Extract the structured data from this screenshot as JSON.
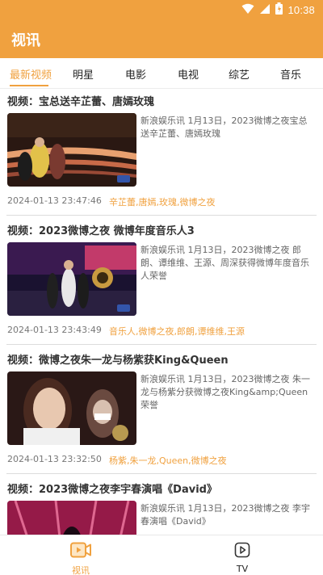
{
  "status_bar": {
    "time": "10:38"
  },
  "app": {
    "title": "视讯"
  },
  "tabs": [
    {
      "label": "最新视频",
      "active": true
    },
    {
      "label": "明星"
    },
    {
      "label": "电影"
    },
    {
      "label": "电视"
    },
    {
      "label": "综艺"
    },
    {
      "label": "音乐"
    }
  ],
  "feed": [
    {
      "title": "视频：宝总送辛芷蕾、唐嫣玫瑰",
      "snippet": "新浪娱乐讯 1月13日，2023微博之夜宝总送辛芷蕾、唐嫣玫瑰",
      "date": "2024-01-13 23:47:46",
      "tags": "辛芷蕾,唐嫣,玫瑰,微博之夜"
    },
    {
      "title": "视频：2023微博之夜 微博年度音乐人3",
      "snippet": "新浪娱乐讯 1月13日，2023微博之夜 郎朗、谭维维、王源、周深获得微博年度音乐人荣誉",
      "date": "2024-01-13 23:43:49",
      "tags": "音乐人,微博之夜,郎朗,谭维维,王源"
    },
    {
      "title": "视频：微博之夜朱一龙与杨紫获King&Queen",
      "snippet": "新浪娱乐讯 1月13日，2023微博之夜 朱一龙与杨紫分获微博之夜King&amp;Queen荣誉",
      "date": "2024-01-13 23:32:50",
      "tags": "杨紫,朱一龙,Queen,微博之夜"
    },
    {
      "title": "视频：2023微博之夜李宇春演唱《David》",
      "snippet": "新浪娱乐讯 1月13日，2023微博之夜 李宇春演唱《David》",
      "date": "",
      "tags": ""
    }
  ],
  "bottom_nav": [
    {
      "label": "视讯",
      "icon": "video-camera-icon",
      "active": true
    },
    {
      "label": "TV",
      "icon": "tv-play-icon",
      "active": false
    }
  ],
  "colors": {
    "accent": "#f0a13f"
  }
}
